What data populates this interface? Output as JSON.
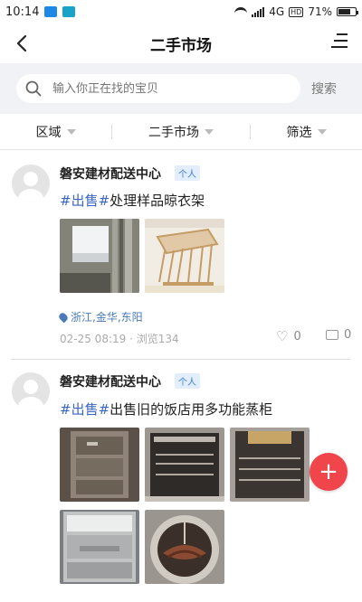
{
  "status": {
    "time": "10:14",
    "network": "4G",
    "hd": "HD",
    "battery": "71%",
    "battery_level": 0.71
  },
  "header": {
    "title": "二手市场"
  },
  "search": {
    "placeholder": "输入你正在找的宝贝",
    "button": "搜索"
  },
  "filters": [
    {
      "label": "区域"
    },
    {
      "label": "二手市场"
    },
    {
      "label": "筛选"
    }
  ],
  "posts": [
    {
      "author": "磐安建材配送中心",
      "badge": "个人",
      "hashtag": "#出售#",
      "text": "处理样品晾衣架",
      "location": "浙江,金华,东阳",
      "meta": "02-25 08:19 · 浏览134",
      "likes": "0",
      "comments": "0"
    },
    {
      "author": "磐安建材配送中心",
      "badge": "个人",
      "hashtag": "#出售#",
      "text": "出售旧的饭店用多功能蒸柜"
    }
  ],
  "fab": {
    "label": "+"
  }
}
